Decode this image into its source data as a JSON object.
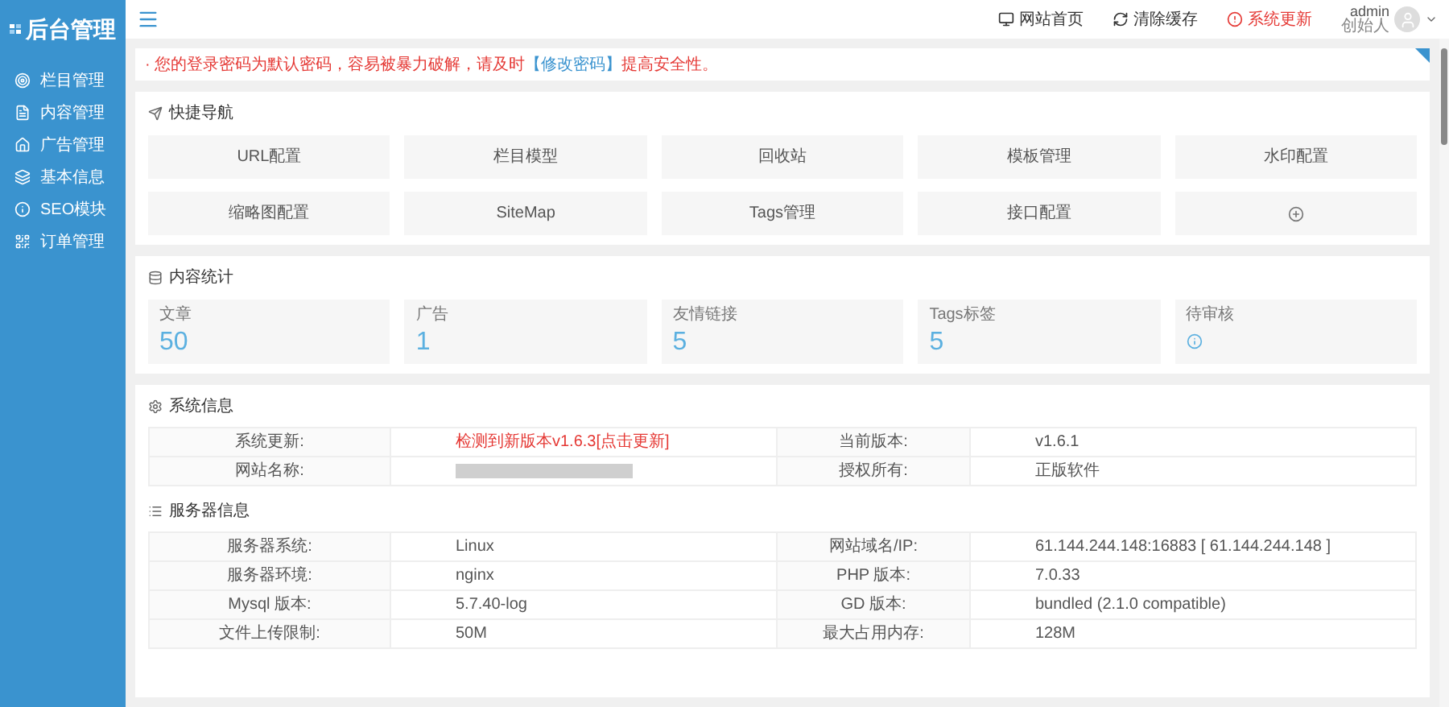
{
  "sidebar": {
    "logo": "后台管理",
    "items": [
      {
        "label": "栏目管理",
        "selected": false
      },
      {
        "label": "内容管理",
        "selected": false
      },
      {
        "label": "广告管理",
        "selected": false
      },
      {
        "label": "基本信息",
        "selected": false
      },
      {
        "label": "SEO模块",
        "selected": false
      },
      {
        "label": "订单管理",
        "selected": false
      }
    ]
  },
  "header": {
    "links": [
      {
        "label": "网站首页",
        "kind": "home"
      },
      {
        "label": "清除缓存",
        "kind": "refresh"
      },
      {
        "label": "系统更新",
        "kind": "alert"
      }
    ],
    "user": {
      "name": "admin",
      "role": "创始人"
    }
  },
  "notice": {
    "text": "· 您的登录密码为默认密码，容易被暴力破解，请及时",
    "link": "【修改密码】",
    "tail": "提高安全性。"
  },
  "quick_nav": {
    "title": "快捷导航",
    "items": [
      {
        "kind": "link",
        "label": "URL配置"
      },
      {
        "kind": "link",
        "label": "栏目模型"
      },
      {
        "kind": "link",
        "label": "回收站"
      },
      {
        "kind": "link",
        "label": "模板管理"
      },
      {
        "kind": "link",
        "label": "水印配置"
      },
      {
        "kind": "link",
        "label": "缩略图配置"
      },
      {
        "kind": "link",
        "label": "SiteMap"
      },
      {
        "kind": "link",
        "label": "Tags管理"
      },
      {
        "kind": "link",
        "label": "接口配置"
      },
      {
        "kind": "add"
      }
    ]
  },
  "stats": {
    "title": "内容统计",
    "items": [
      {
        "kind": "number",
        "label": "文章",
        "value": "50"
      },
      {
        "kind": "number",
        "label": "广告",
        "value": "1"
      },
      {
        "kind": "number",
        "label": "友情链接",
        "value": "5"
      },
      {
        "kind": "number",
        "label": "Tags标签",
        "value": "5"
      },
      {
        "kind": "info",
        "label": "待审核"
      }
    ]
  },
  "system": {
    "title": "系统信息",
    "rows": [
      [
        {
          "kind": "label",
          "text": "系统更新:"
        },
        {
          "kind": "alert",
          "text": "检测到新版本v1.6.3[点击更新]"
        },
        {
          "kind": "label",
          "text": "当前版本:"
        },
        {
          "kind": "value",
          "text": "v1.6.1"
        }
      ],
      [
        {
          "kind": "label",
          "text": "网站名称:"
        },
        {
          "kind": "blurred"
        },
        {
          "kind": "label",
          "text": "授权所有:"
        },
        {
          "kind": "value",
          "text": "正版软件"
        }
      ]
    ]
  },
  "server": {
    "title": "服务器信息",
    "rows": [
      [
        {
          "kind": "label",
          "text": "服务器系统:"
        },
        {
          "kind": "value",
          "text": "Linux"
        },
        {
          "kind": "label",
          "text": "网站域名/IP:"
        },
        {
          "kind": "value",
          "text": "61.144.244.148:16883 [ 61.144.244.148 ]"
        }
      ],
      [
        {
          "kind": "label",
          "text": "服务器环境:"
        },
        {
          "kind": "value",
          "text": "nginx"
        },
        {
          "kind": "label",
          "text": "PHP 版本:"
        },
        {
          "kind": "value",
          "text": "7.0.33"
        }
      ],
      [
        {
          "kind": "label",
          "text": "Mysql 版本:"
        },
        {
          "kind": "value",
          "text": "5.7.40-log"
        },
        {
          "kind": "label",
          "text": "GD 版本:"
        },
        {
          "kind": "value",
          "text": "bundled (2.1.0 compatible)"
        }
      ],
      [
        {
          "kind": "label",
          "text": "文件上传限制:"
        },
        {
          "kind": "value",
          "text": "50M"
        },
        {
          "kind": "label",
          "text": "最大占用内存:"
        },
        {
          "kind": "value",
          "text": "128M"
        }
      ]
    ]
  }
}
